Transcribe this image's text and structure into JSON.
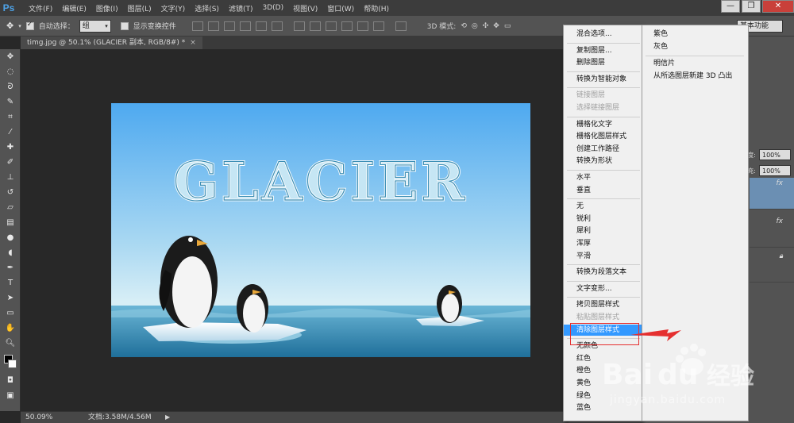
{
  "app": {
    "logo": "Ps"
  },
  "menubar": {
    "items": [
      "文件(F)",
      "编辑(E)",
      "图像(I)",
      "图层(L)",
      "文字(Y)",
      "选择(S)",
      "滤镜(T)",
      "3D(D)",
      "视图(V)",
      "窗口(W)",
      "帮助(H)"
    ]
  },
  "window_controls": {
    "minimize": "—",
    "restore": "❐",
    "close": "✕"
  },
  "options": {
    "auto_select_label": "自动选择：",
    "auto_select_value": "组",
    "show_transform_label": "显示变换控件",
    "mode3d_label": "3D 模式:",
    "workspace": "基本功能"
  },
  "document": {
    "tab": "timg.jpg @ 50.1% (GLACIER 副本, RGB/8#) *",
    "close": "×"
  },
  "canvas": {
    "title_text": "GLACIER"
  },
  "status": {
    "zoom": "50.09%",
    "doc": "文档:3.58M/4.56M",
    "arrow": "▶"
  },
  "layers_panel": {
    "opacity_label": "度:",
    "opacity": "100%",
    "fill_label": "充:",
    "fill": "100%",
    "fx": "fx"
  },
  "context_menu": {
    "items": [
      {
        "label": "混合选项...",
        "disabled": false
      },
      {
        "sep": true
      },
      {
        "label": "复制图层...",
        "disabled": false
      },
      {
        "label": "删除图层",
        "disabled": false
      },
      {
        "sep": true
      },
      {
        "label": "转换为智能对象",
        "disabled": false
      },
      {
        "sep": true
      },
      {
        "label": "链接图层",
        "disabled": true
      },
      {
        "label": "选择链接图层",
        "disabled": true
      },
      {
        "sep": true
      },
      {
        "label": "栅格化文字",
        "disabled": false
      },
      {
        "label": "栅格化图层样式",
        "disabled": false
      },
      {
        "label": "创建工作路径",
        "disabled": false
      },
      {
        "label": "转换为形状",
        "disabled": false
      },
      {
        "sep": true
      },
      {
        "label": "水平",
        "disabled": false
      },
      {
        "label": "垂直",
        "disabled": false
      },
      {
        "sep": true
      },
      {
        "label": "无",
        "disabled": false
      },
      {
        "label": "锐利",
        "disabled": false
      },
      {
        "label": "犀利",
        "disabled": false
      },
      {
        "label": "浑厚",
        "disabled": false
      },
      {
        "label": "平滑",
        "disabled": false
      },
      {
        "sep": true
      },
      {
        "label": "转换为段落文本",
        "disabled": false
      },
      {
        "sep": true
      },
      {
        "label": "文字变形...",
        "disabled": false
      },
      {
        "sep": true
      },
      {
        "label": "拷贝图层样式",
        "disabled": false
      },
      {
        "label": "粘贴图层样式",
        "disabled": true
      },
      {
        "label": "清除图层样式",
        "disabled": false,
        "highlighted": true
      },
      {
        "sep": true
      },
      {
        "label": "无颜色",
        "disabled": false
      },
      {
        "label": "红色",
        "disabled": false
      },
      {
        "label": "橙色",
        "disabled": false
      },
      {
        "label": "黄色",
        "disabled": false
      },
      {
        "label": "绿色",
        "disabled": false
      },
      {
        "label": "蓝色",
        "disabled": false
      }
    ]
  },
  "submenu": {
    "items": [
      {
        "label": "紫色"
      },
      {
        "label": "灰色"
      },
      {
        "sep": true
      },
      {
        "label": "明信片"
      },
      {
        "label": "从所选图层新建 3D 凸出"
      }
    ]
  },
  "watermark": {
    "brand": "Bai",
    "brand2": "du",
    "cn": "经验",
    "url": "jingyan.baidu.com"
  },
  "colors": {
    "highlight": "#3399ff",
    "annotation": "#e53030",
    "ps_blue": "#4ea3e8"
  }
}
